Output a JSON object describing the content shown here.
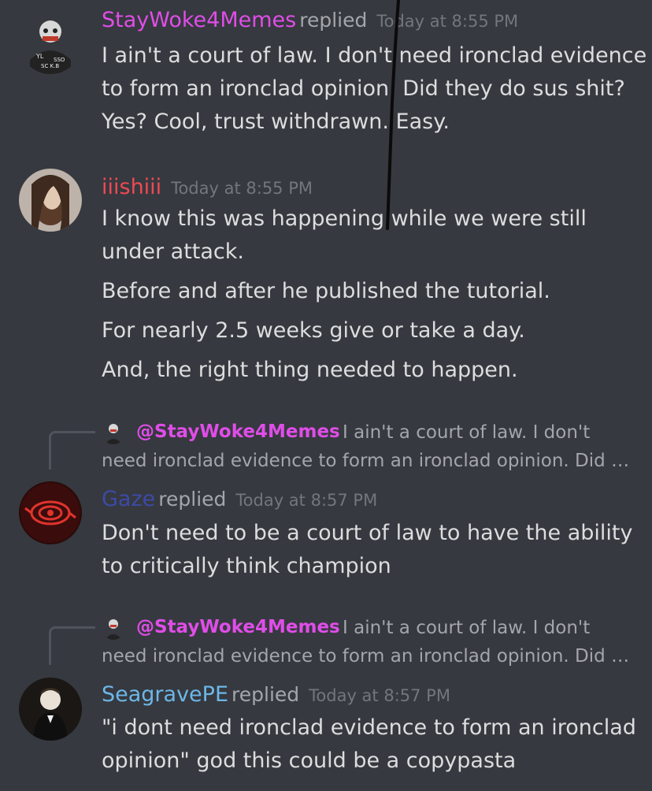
{
  "colors": {
    "background": "#36393f",
    "stayWoke": "#e04de8",
    "iiishiii": "#ee4a54",
    "gaze": "#3d4aa8",
    "seagrave": "#6cb7e9",
    "text": "#dcddde",
    "muted": "#a3a6aa",
    "timestamp": "#72767d"
  },
  "messages": [
    {
      "username": "StayWoke4Memes",
      "replied": "replied",
      "timestamp": "Today at 8:55 PM",
      "lines": [
        "I ain't a court of law. I don't need ironclad evidence",
        "to form an ironclad opinion. Did they do sus shit?",
        "Yes? Cool, trust withdrawn. Easy."
      ]
    },
    {
      "username": "iiishiii",
      "timestamp": "Today at 8:55 PM",
      "lines": [
        "I know this was happening while we were still",
        "under attack.",
        "Before and after he published the tutorial.",
        "For nearly 2.5 weeks give or take a day.",
        "And, the right thing needed to happen."
      ]
    },
    {
      "reply_to": {
        "mention": "@StayWoke4Memes",
        "text_line1": "I ain't a court of law. I don't",
        "text_line2": "need ironclad evidence to form an ironclad opinion. Did …"
      },
      "username": "Gaze",
      "replied": "replied",
      "timestamp": "Today at 8:57 PM",
      "lines": [
        "Don't need to be a court of law to have the ability",
        "to critically think champion"
      ]
    },
    {
      "reply_to": {
        "mention": "@StayWoke4Memes",
        "text_line1": "I ain't a court of law. I don't",
        "text_line2": "need ironclad evidence to form an ironclad opinion. Did …"
      },
      "username": "SeagravePE",
      "replied": "replied",
      "timestamp": "Today at 8:57 PM",
      "lines": [
        "\"i dont need ironclad evidence to form an ironclad",
        "opinion\" god this could be a copypasta"
      ]
    }
  ]
}
